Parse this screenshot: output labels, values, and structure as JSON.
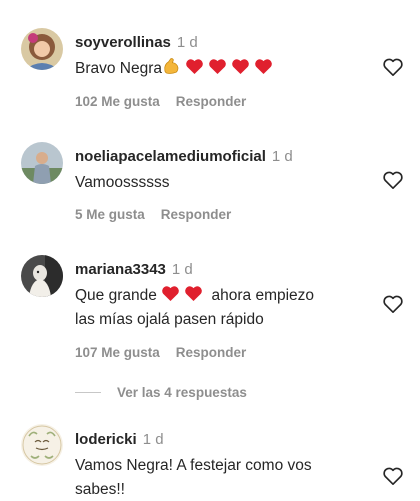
{
  "comments": [
    {
      "username": "soyverollinas",
      "time": "1 d",
      "text": "Bravo Negra",
      "likes": "102 Me gusta",
      "reply": "Responder",
      "emoji_after": [
        "flexed-biceps",
        "red-heart",
        "red-heart",
        "red-heart",
        "red-heart"
      ]
    },
    {
      "username": "noeliapacelamediumoficial",
      "time": "1 d",
      "text": "Vamoossssss",
      "likes": "5 Me gusta",
      "reply": "Responder"
    },
    {
      "username": "mariana3343",
      "time": "1 d",
      "text_before": "Que grande",
      "text_after": "ahora empiezo",
      "text_line2": "las mías ojalá pasen rápido",
      "likes": "107 Me gusta",
      "reply": "Responder",
      "emoji_inline": [
        "red-heart",
        "red-heart"
      ],
      "replies_toggle": "Ver las 4 respuestas"
    },
    {
      "username": "lodericki",
      "time": "1 d",
      "text_line1": "Vamos Negra! A festejar como vos",
      "text_line2": "sabes!!"
    }
  ],
  "colors": {
    "primary_text": "#262626",
    "secondary_text": "#8e8e8e",
    "heart_emoji": "#e0202e",
    "like_outline": "#262626"
  },
  "icons": {
    "like": "heart-outline-icon"
  }
}
